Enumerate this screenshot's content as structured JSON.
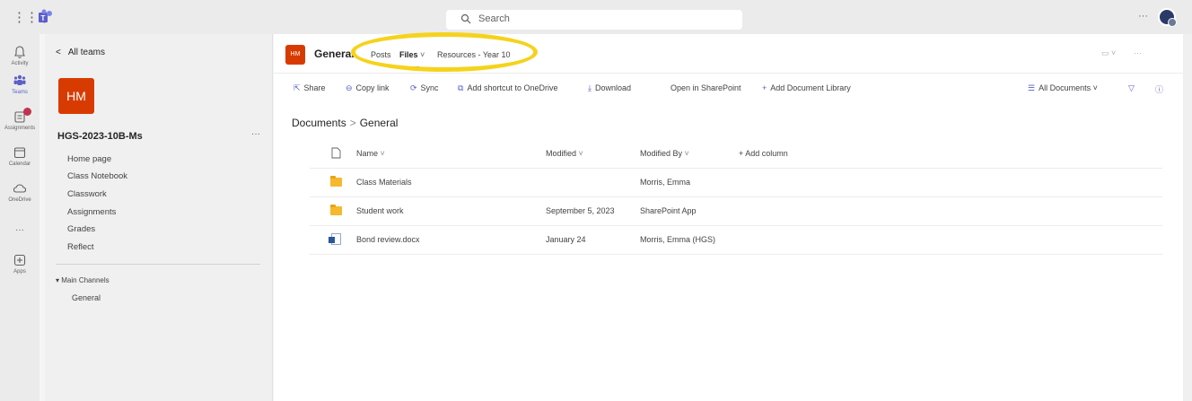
{
  "topbar": {
    "search_placeholder": "Search",
    "more": "···"
  },
  "rail": [
    {
      "label": "Activity",
      "icon": "bell-icon"
    },
    {
      "label": "Teams",
      "icon": "teams-icon"
    },
    {
      "label": "Assignments",
      "icon": "assignments-icon"
    },
    {
      "label": "Calendar",
      "icon": "calendar-icon"
    },
    {
      "label": "OneDrive",
      "icon": "cloud-icon"
    },
    {
      "label": "···",
      "icon": "more-icon"
    },
    {
      "label": "Apps",
      "icon": "plus-box-icon"
    }
  ],
  "leftpanel": {
    "back_label": "All teams",
    "team_initials": "HM",
    "team_name": "HGS-2023-10B-Ms",
    "team_more": "···",
    "nav": [
      "Home page",
      "Class Notebook",
      "Classwork",
      "Assignments",
      "Grades",
      "Reflect"
    ],
    "channels_header": "Main Channels",
    "channels": [
      "General"
    ]
  },
  "channel": {
    "initials": "HM",
    "title": "General",
    "tabs": [
      "Posts",
      "Files",
      "Resources - Year 10"
    ],
    "active_tab": "Files"
  },
  "toolbar": {
    "items": [
      "Share",
      "Copy link",
      "Sync",
      "Add shortcut to OneDrive",
      "Download",
      "Open in SharePoint",
      "Add Document Library"
    ],
    "view": "All Documents"
  },
  "breadcrumb": [
    "Documents",
    "General"
  ],
  "table": {
    "headers": [
      "Name",
      "Modified",
      "Modified By",
      "+ Add column"
    ],
    "rows": [
      {
        "name": "Class Materials",
        "modified": "",
        "modified_by": "Morris, Emma",
        "type": "folder-shared"
      },
      {
        "name": "Student work",
        "modified": "September 5, 2023",
        "modified_by": "SharePoint App",
        "type": "folder"
      },
      {
        "name": "Bond review.docx",
        "modified": "January 24",
        "modified_by": "Morris, Emma (HGS)",
        "type": "word-doc"
      }
    ]
  },
  "colors": {
    "accent": "#5b5fc7",
    "team_avatar": "#d83b01",
    "highlight": "#f5d31c"
  }
}
